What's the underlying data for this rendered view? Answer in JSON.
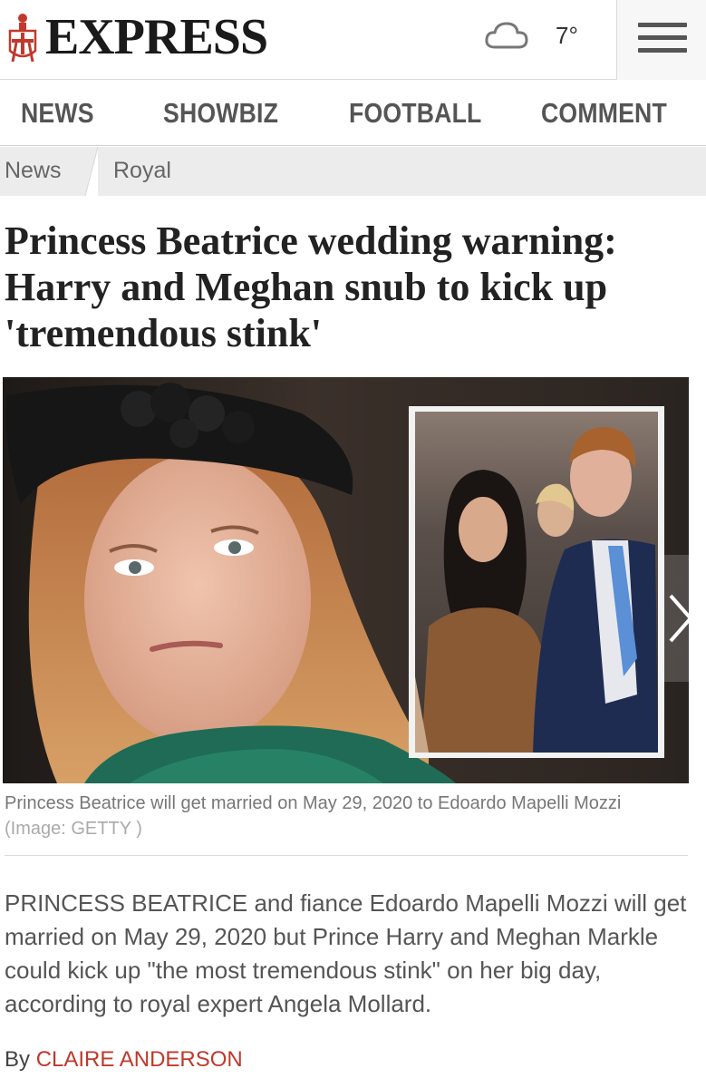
{
  "header": {
    "logo_text": "EXPRESS",
    "weather_icon": "cloud-icon",
    "temperature": "7°",
    "menu_icon": "hamburger-menu-icon"
  },
  "nav": {
    "items": [
      {
        "label": "NEWS"
      },
      {
        "label": "SHOWBIZ"
      },
      {
        "label": "FOOTBALL"
      },
      {
        "label": "COMMENT"
      }
    ]
  },
  "breadcrumb": {
    "items": [
      {
        "label": "News"
      },
      {
        "label": "Royal"
      }
    ]
  },
  "article": {
    "headline": "Princess Beatrice wedding warning: Harry and Meghan snub to kick up 'tremendous stink'",
    "caption": "Princess Beatrice will get married on May 29, 2020 to Edoardo Mapelli Mozzi",
    "caption_credit": "(Image: GETTY )",
    "standfirst": "PRINCESS BEATRICE and fiance Edoardo Mapelli Mozzi will get married on May 29, 2020 but Prince Harry and Meghan Markle could kick up \"the most tremendous stink\" on her big day, according to royal expert Angela Mollard.",
    "byline_prefix": "By",
    "author": "CLAIRE ANDERSON",
    "next_icon": "chevron-right-icon"
  },
  "colors": {
    "author_link": "#c0392b",
    "logo_crest": "#c0392b"
  }
}
